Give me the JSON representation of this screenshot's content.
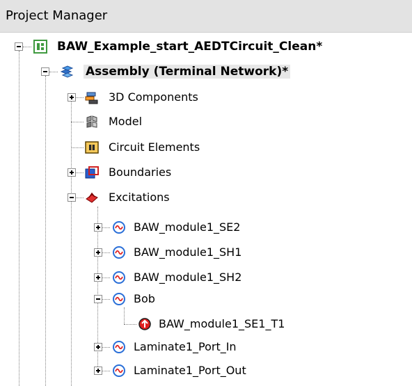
{
  "panel": {
    "title": "Project Manager"
  },
  "tree": {
    "project": {
      "label": "BAW_Example_start_AEDTCircuit_Clean*"
    },
    "assembly": {
      "label": "Assembly (Terminal Network)*"
    },
    "items": {
      "components_3d": "3D Components",
      "model": "Model",
      "circuit_elements": "Circuit Elements",
      "boundaries": "Boundaries",
      "excitations": "Excitations"
    },
    "excitations": [
      {
        "label": "BAW_module1_SE2"
      },
      {
        "label": "BAW_module1_SH1"
      },
      {
        "label": "BAW_module1_SH2"
      },
      {
        "label": "Bob"
      },
      {
        "label": "BAW_module1_SE1_T1"
      },
      {
        "label": "Laminate1_Port_In"
      },
      {
        "label": "Laminate1_Port_Out"
      }
    ]
  },
  "colors": {
    "header_bg": "#e3e3e3",
    "selected_bg": "#e7e7e7",
    "excitation_icon": "#2a6fd8",
    "excitation_wave": "#e02020"
  }
}
